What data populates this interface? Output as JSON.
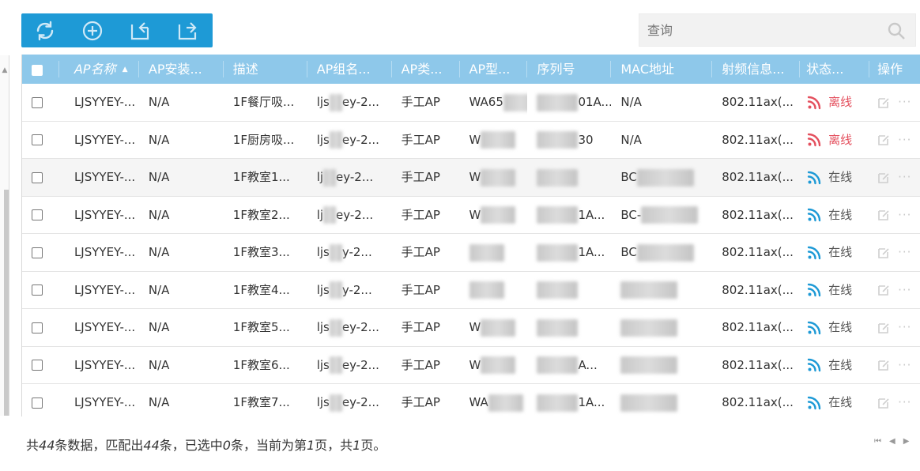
{
  "toolbar": {
    "buttons": [
      {
        "icon": "refresh-icon"
      },
      {
        "icon": "add-circle-icon"
      },
      {
        "icon": "import-icon"
      },
      {
        "icon": "export-icon"
      }
    ],
    "color": "#1e9ad6"
  },
  "search": {
    "placeholder": "查询"
  },
  "table": {
    "header_color": "#8ec8ea",
    "columns": [
      "AP名称",
      "AP安装...",
      "描述",
      "AP组名...",
      "AP类...",
      "AP型...",
      "序列号",
      "MAC地址",
      "射频信息...",
      "状态...",
      "操作"
    ],
    "sorted_column": "AP名称",
    "rows": [
      {
        "name": "LJSYYEY-...",
        "install": "N/A",
        "desc": "1F餐厅吸...",
        "group": "ljs",
        "group_tail": "ey-2...",
        "type": "手工AP",
        "model": "WA65",
        "serial_tail": "01A...",
        "mac": "N/A",
        "radio": "802.11ax(...",
        "status": "离线",
        "online": false
      },
      {
        "name": "LJSYYEY-...",
        "install": "N/A",
        "desc": "1F厨房吸...",
        "group": "ljs",
        "group_tail": "ey-2...",
        "type": "手工AP",
        "model": "W",
        "serial_tail": "30",
        "mac": "N/A",
        "radio": "802.11ax(...",
        "status": "离线",
        "online": false
      },
      {
        "name": "LJSYYEY-...",
        "install": "N/A",
        "desc": "1F教室1...",
        "group": "lj",
        "group_tail": "ey-2...",
        "type": "手工AP",
        "model": "W",
        "serial_tail": "",
        "mac": "BC",
        "radio": "802.11ax(...",
        "status": "在线",
        "online": true
      },
      {
        "name": "LJSYYEY-...",
        "install": "N/A",
        "desc": "1F教室2...",
        "group": "lj",
        "group_tail": "ey-2...",
        "type": "手工AP",
        "model": "W",
        "serial_tail": "1A...",
        "mac": "BC-",
        "radio": "802.11ax(...",
        "status": "在线",
        "online": true
      },
      {
        "name": "LJSYYEY-...",
        "install": "N/A",
        "desc": "1F教室3...",
        "group": "ljs",
        "group_tail": "y-2...",
        "type": "手工AP",
        "model": "",
        "serial_tail": "1A...",
        "mac": "BC",
        "radio": "802.11ax(...",
        "status": "在线",
        "online": true
      },
      {
        "name": "LJSYYEY-...",
        "install": "N/A",
        "desc": "1F教室4...",
        "group": "ljs",
        "group_tail": "y-2...",
        "type": "手工AP",
        "model": "",
        "serial_tail": "",
        "mac": "",
        "radio": "802.11ax(...",
        "status": "在线",
        "online": true
      },
      {
        "name": "LJSYYEY-...",
        "install": "N/A",
        "desc": "1F教室5...",
        "group": "ljs",
        "group_tail": "ey-2...",
        "type": "手工AP",
        "model": "W",
        "serial_tail": "",
        "mac": "",
        "radio": "802.11ax(...",
        "status": "在线",
        "online": true
      },
      {
        "name": "LJSYYEY-...",
        "install": "N/A",
        "desc": "1F教室6...",
        "group": "ljs",
        "group_tail": "ey-2...",
        "type": "手工AP",
        "model": "W",
        "serial_tail": "A...",
        "mac": "",
        "radio": "802.11ax(...",
        "status": "在线",
        "online": true
      },
      {
        "name": "LJSYYEY-...",
        "install": "N/A",
        "desc": "1F教室7...",
        "group": "ljs",
        "group_tail": "ey-2...",
        "type": "手工AP",
        "model": "WA",
        "serial_tail": "1A...",
        "mac": "",
        "radio": "802.11ax(...",
        "status": "在线",
        "online": true
      }
    ]
  },
  "footer": {
    "p1": "共",
    "total": "44",
    "p2": "条数据，匹配出",
    "matched": "44",
    "p3": "条，已选中",
    "selected": "0",
    "p4": "条，当前为第",
    "page": "1",
    "p5": "页，共",
    "pages": "1",
    "p6": "页。"
  },
  "status_colors": {
    "offline": "#e4505e",
    "online": "#1e9ad6"
  }
}
